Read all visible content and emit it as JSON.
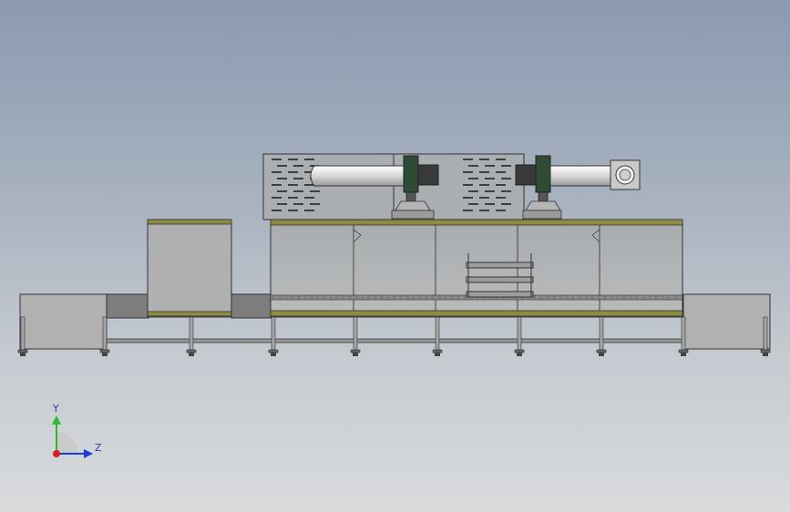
{
  "viewport": {
    "background_top": "#8c9ab0",
    "background_bottom": "#d9dbdd",
    "model_colors": {
      "panel": "#b3b3b3",
      "panel_dark": "#8a8a8a",
      "outline": "#2a2a2a",
      "accent_trim": "#8a8a3a",
      "pipe": "#e6e6e6",
      "motor": "#2f4a35"
    }
  },
  "triad": {
    "x_axis_label": "Z",
    "y_axis_label": "Y",
    "x_axis_color": "#1f3bd6",
    "y_axis_color": "#2dbb2d",
    "z_axis_color": "#d62020"
  }
}
